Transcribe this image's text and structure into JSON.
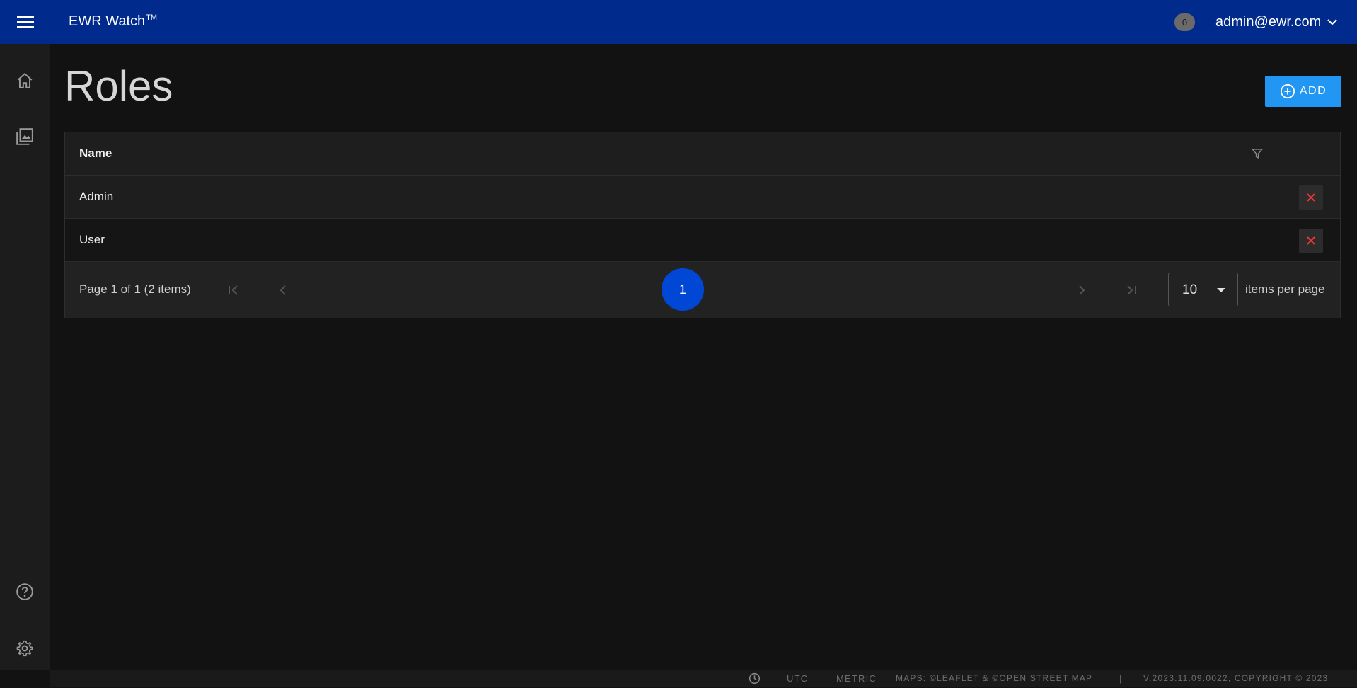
{
  "header": {
    "app_name": "EWR Watch",
    "trademark": "TM",
    "notification_count": "0",
    "user_email": "admin@ewr.com",
    "bg_color": "#002b8c"
  },
  "sidebar": {
    "items": [
      {
        "icon": "home-icon"
      },
      {
        "icon": "image-gallery-icon"
      },
      {
        "icon": "help-icon"
      },
      {
        "icon": "gear-icon"
      }
    ]
  },
  "page": {
    "title": "Roles",
    "add_label": "ADD"
  },
  "table": {
    "columns": [
      "Name"
    ],
    "rows": [
      {
        "name": "Admin"
      },
      {
        "name": "User"
      }
    ]
  },
  "pager": {
    "info": "Page 1 of 1 (2 items)",
    "current_page": "1",
    "page_size": "10",
    "items_per_page_label": "items per page"
  },
  "footer": {
    "timezone": "UTC",
    "units": "METRIC",
    "maps_credit": "MAPS: ©LEAFLET & ©OPEN STREET MAP",
    "separator": "|",
    "version": "V.2023.11.09.0022, COPYRIGHT © 2023"
  },
  "colors": {
    "accent": "#2196f3",
    "current_page": "#0047d6",
    "delete": "#e53935"
  }
}
